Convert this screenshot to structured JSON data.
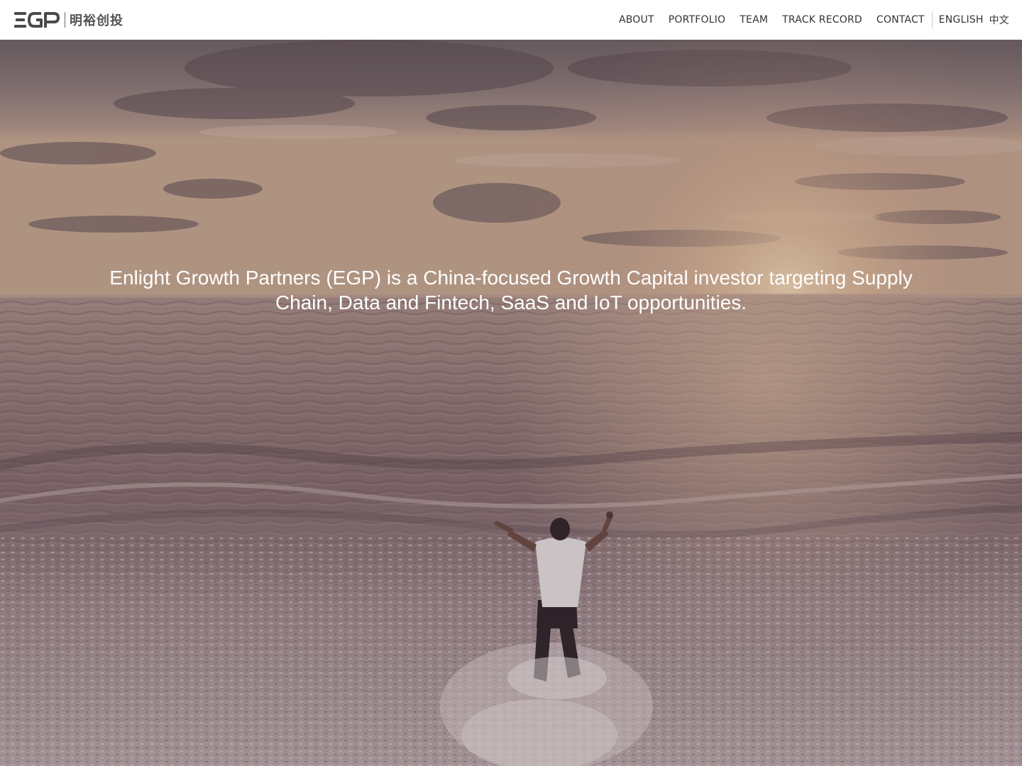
{
  "header": {
    "logo": {
      "mark": "EGP",
      "chinese_name": "明裕创投"
    },
    "nav": {
      "items": [
        {
          "label": "ABOUT"
        },
        {
          "label": "PORTFOLIO"
        },
        {
          "label": "TEAM"
        },
        {
          "label": "TRACK RECORD"
        },
        {
          "label": "CONTACT"
        }
      ],
      "languages": [
        {
          "label": "ENGLISH"
        },
        {
          "label": "中文"
        }
      ]
    }
  },
  "hero": {
    "tagline": "Enlight Growth Partners (EGP) is a China-focused Growth Capital investor targeting Supply Chain, Data and Fintech, SaaS and IoT opportunities.",
    "image": "person-in-ocean-waves-at-sunset"
  },
  "colors": {
    "header_bg": "#ffffff",
    "nav_text": "#333333",
    "logo": "#4a4a4a",
    "hero_text": "#ffffff"
  }
}
